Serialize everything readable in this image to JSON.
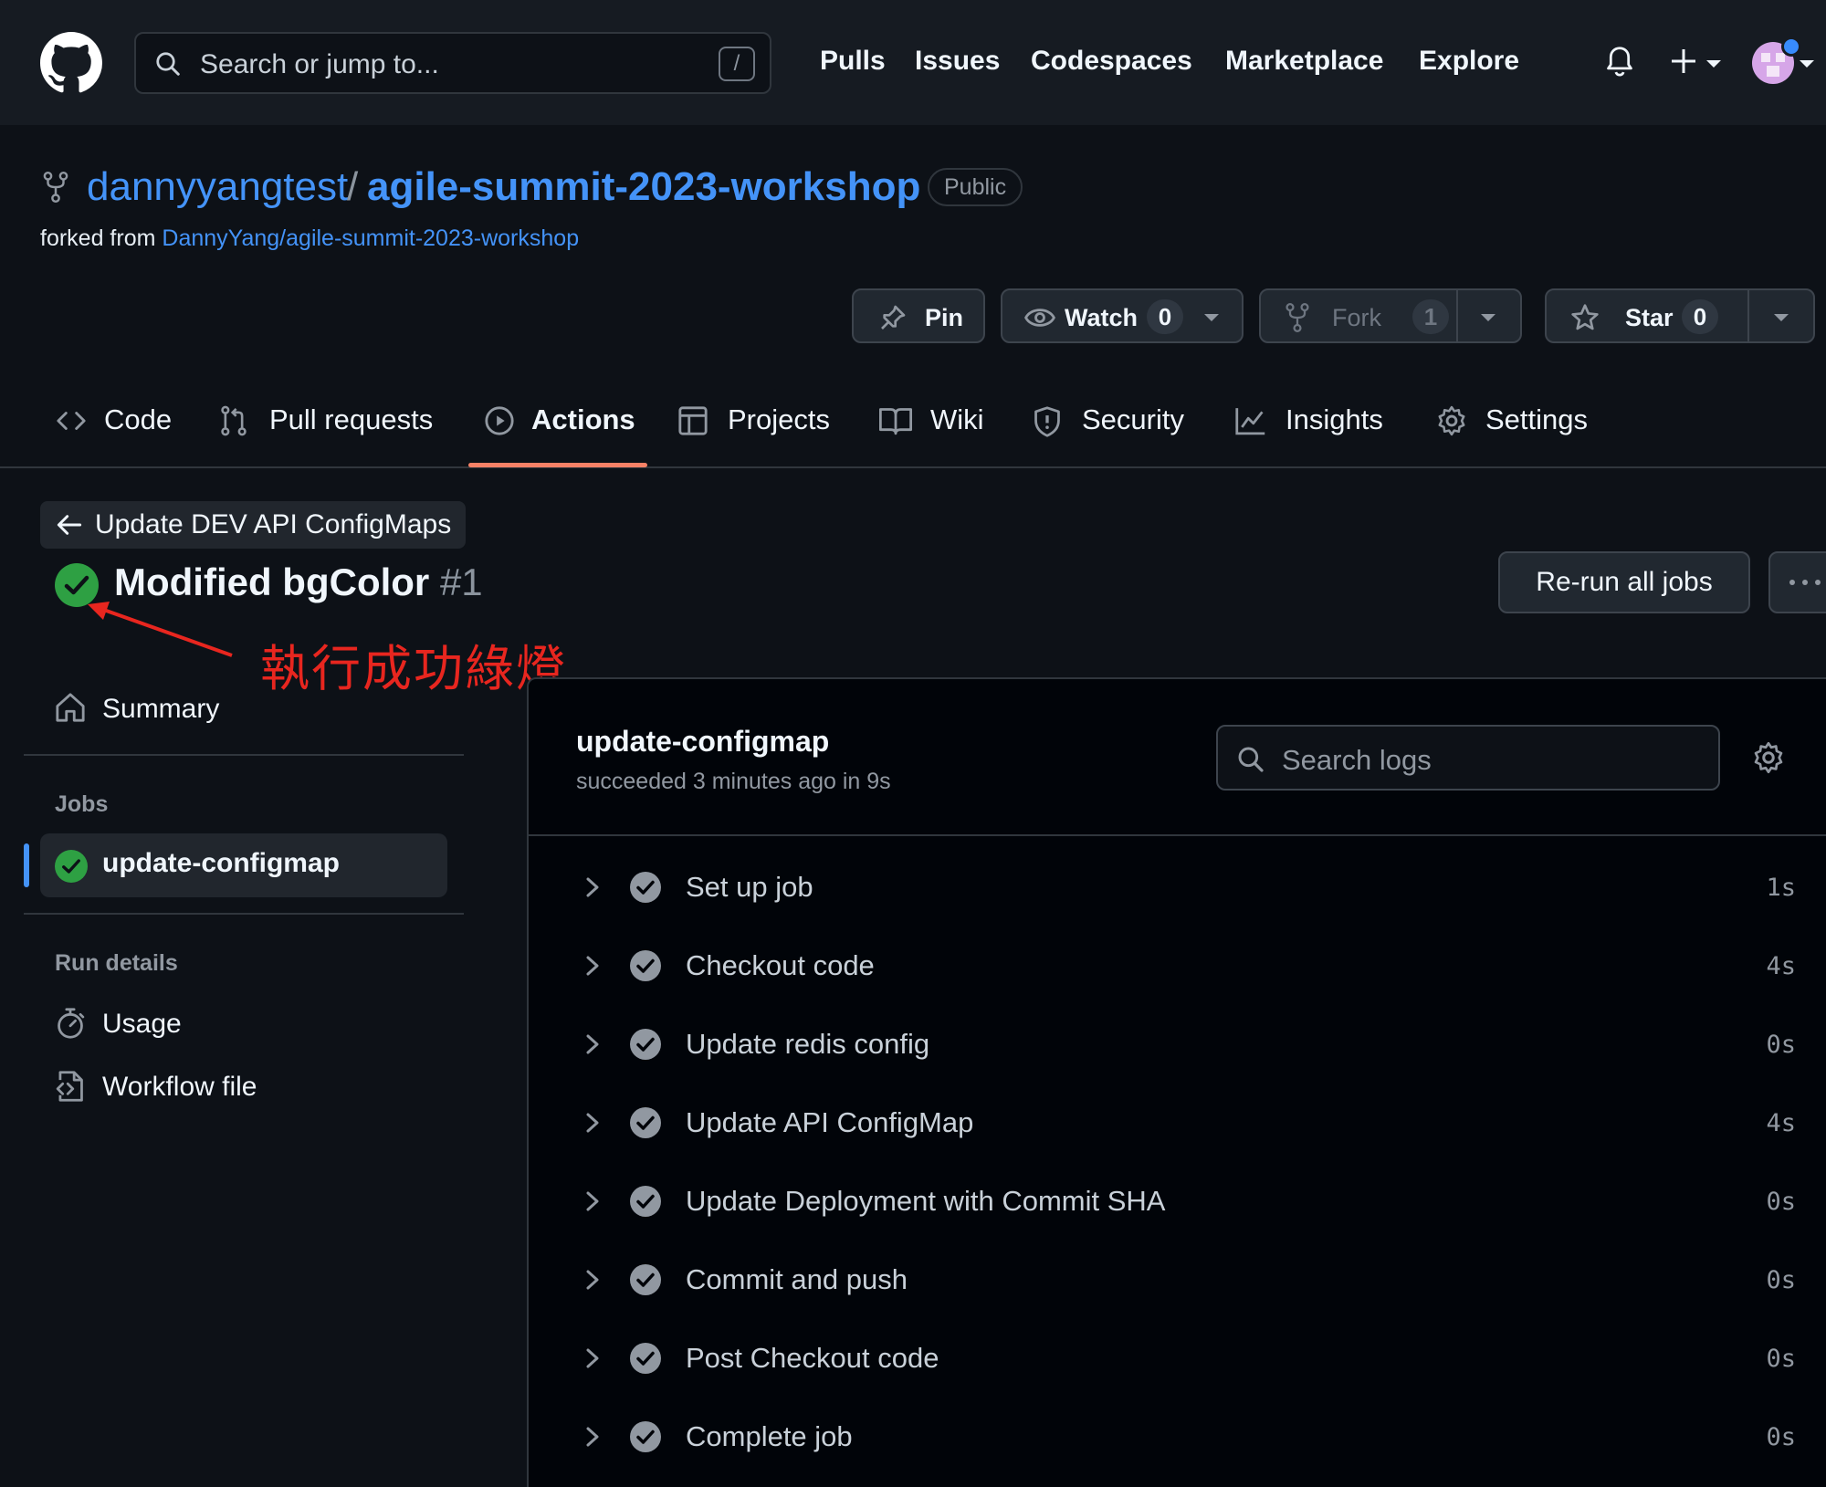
{
  "header": {
    "search_placeholder": "Search or jump to...",
    "search_shortcut": "/",
    "nav": [
      "Pulls",
      "Issues",
      "Codespaces",
      "Marketplace",
      "Explore"
    ]
  },
  "repo": {
    "owner": "dannyyangtest",
    "separator": "/",
    "name": "agile-summit-2023-workshop",
    "visibility": "Public",
    "forked_prefix": "forked from",
    "forked_from": "DannyYang/agile-summit-2023-workshop",
    "actions": {
      "pin": "Pin",
      "watch": "Watch",
      "watch_count": "0",
      "fork": "Fork",
      "fork_count": "1",
      "star": "Star",
      "star_count": "0"
    }
  },
  "tabs": {
    "code": "Code",
    "pull_requests": "Pull requests",
    "actions": "Actions",
    "projects": "Projects",
    "wiki": "Wiki",
    "security": "Security",
    "insights": "Insights",
    "settings": "Settings",
    "active": "Actions"
  },
  "run": {
    "back_label": "Update DEV API ConfigMaps",
    "title": "Modified bgColor",
    "number": "#1",
    "rerun_label": "Re-run all jobs",
    "annotation": "執行成功綠燈"
  },
  "sidebar": {
    "summary": "Summary",
    "jobs_heading": "Jobs",
    "job": "update-configmap",
    "run_details_heading": "Run details",
    "usage": "Usage",
    "workflow_file": "Workflow file"
  },
  "job_panel": {
    "name": "update-configmap",
    "status": "succeeded 3 minutes ago in 9s",
    "search_placeholder": "Search logs",
    "steps": [
      {
        "name": "Set up job",
        "time": "1s"
      },
      {
        "name": "Checkout code",
        "time": "4s"
      },
      {
        "name": "Update redis config",
        "time": "0s"
      },
      {
        "name": "Update API ConfigMap",
        "time": "4s"
      },
      {
        "name": "Update Deployment with Commit SHA",
        "time": "0s"
      },
      {
        "name": "Commit and push",
        "time": "0s"
      },
      {
        "name": "Post Checkout code",
        "time": "0s"
      },
      {
        "name": "Complete job",
        "time": "0s"
      }
    ]
  },
  "colors": {
    "success": "#2ea043",
    "link": "#4493f8",
    "tab_underline": "#f78166",
    "annotation": "#e8261f"
  }
}
